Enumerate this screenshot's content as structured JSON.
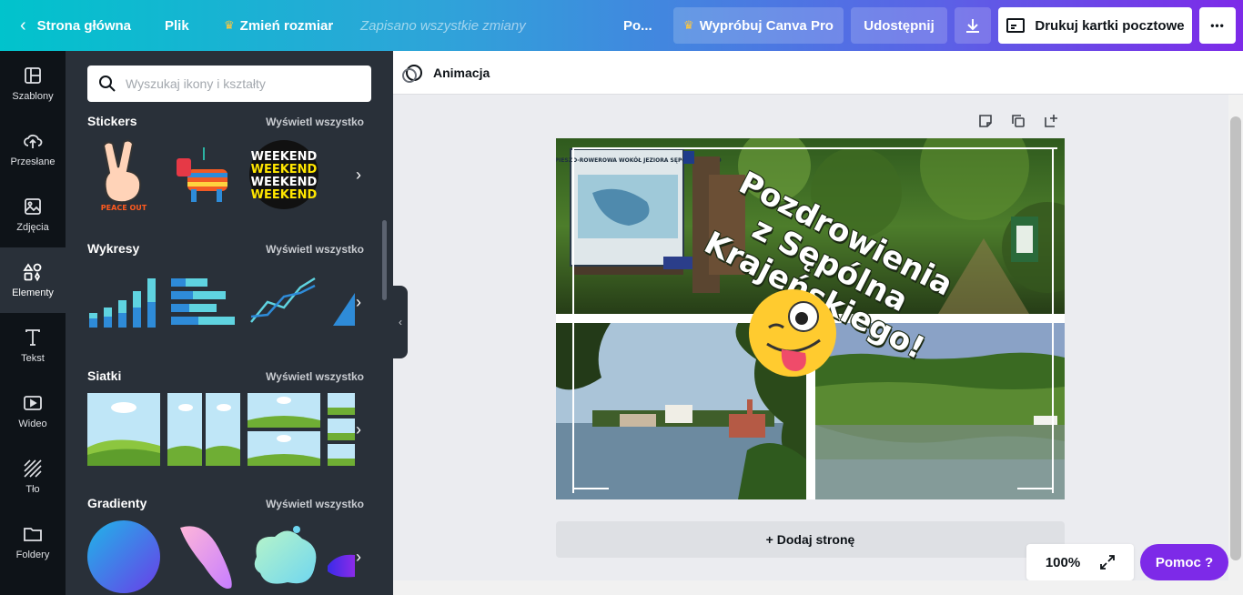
{
  "topbar": {
    "home": "Strona główna",
    "file": "Plik",
    "resize": "Zmień rozmiar",
    "saved": "Zapisano wszystkie zmiany",
    "title": "Po...",
    "try_pro": "Wypróbuj Canva Pro",
    "share": "Udostępnij",
    "print": "Drukuj kartki pocztowe",
    "more": "•••"
  },
  "rail": [
    {
      "label": "Szablony",
      "icon": "templates-icon"
    },
    {
      "label": "Przesłane",
      "icon": "upload-cloud-icon"
    },
    {
      "label": "Zdjęcia",
      "icon": "photo-icon"
    },
    {
      "label": "Elementy",
      "icon": "elements-icon"
    },
    {
      "label": "Tekst",
      "icon": "text-icon"
    },
    {
      "label": "Wideo",
      "icon": "video-icon"
    },
    {
      "label": "Tło",
      "icon": "background-icon"
    },
    {
      "label": "Foldery",
      "icon": "folder-icon"
    }
  ],
  "panel": {
    "search_placeholder": "Wyszukaj ikony i kształty",
    "sections": [
      {
        "title": "Stickers",
        "link": "Wyświetl wszystko"
      },
      {
        "title": "Wykresy",
        "link": "Wyświetl wszystko"
      },
      {
        "title": "Siatki",
        "link": "Wyświetl wszystko"
      },
      {
        "title": "Gradienty",
        "link": "Wyświetl wszystko"
      }
    ],
    "sticker_texts": {
      "peace": "PEACE OUT",
      "weekend": "WEEKEND"
    }
  },
  "canvas": {
    "animation": "Animacja",
    "headline": [
      "Pozdrowienia",
      "z Sępólna",
      "Krajeńskiego!"
    ],
    "sign_text": "TRASA PIESZO-ROWEROWA WOKÓŁ JEZIORA SĘPOLEŃSKIEGO",
    "add_page": "+ Dodaj stronę",
    "zoom": "100%",
    "help": "Pomoc ?"
  },
  "colors": {
    "brand_purple": "#7d2ae8",
    "teal": "#01c3cc",
    "dark": "#0e1318",
    "panel": "#293039"
  }
}
